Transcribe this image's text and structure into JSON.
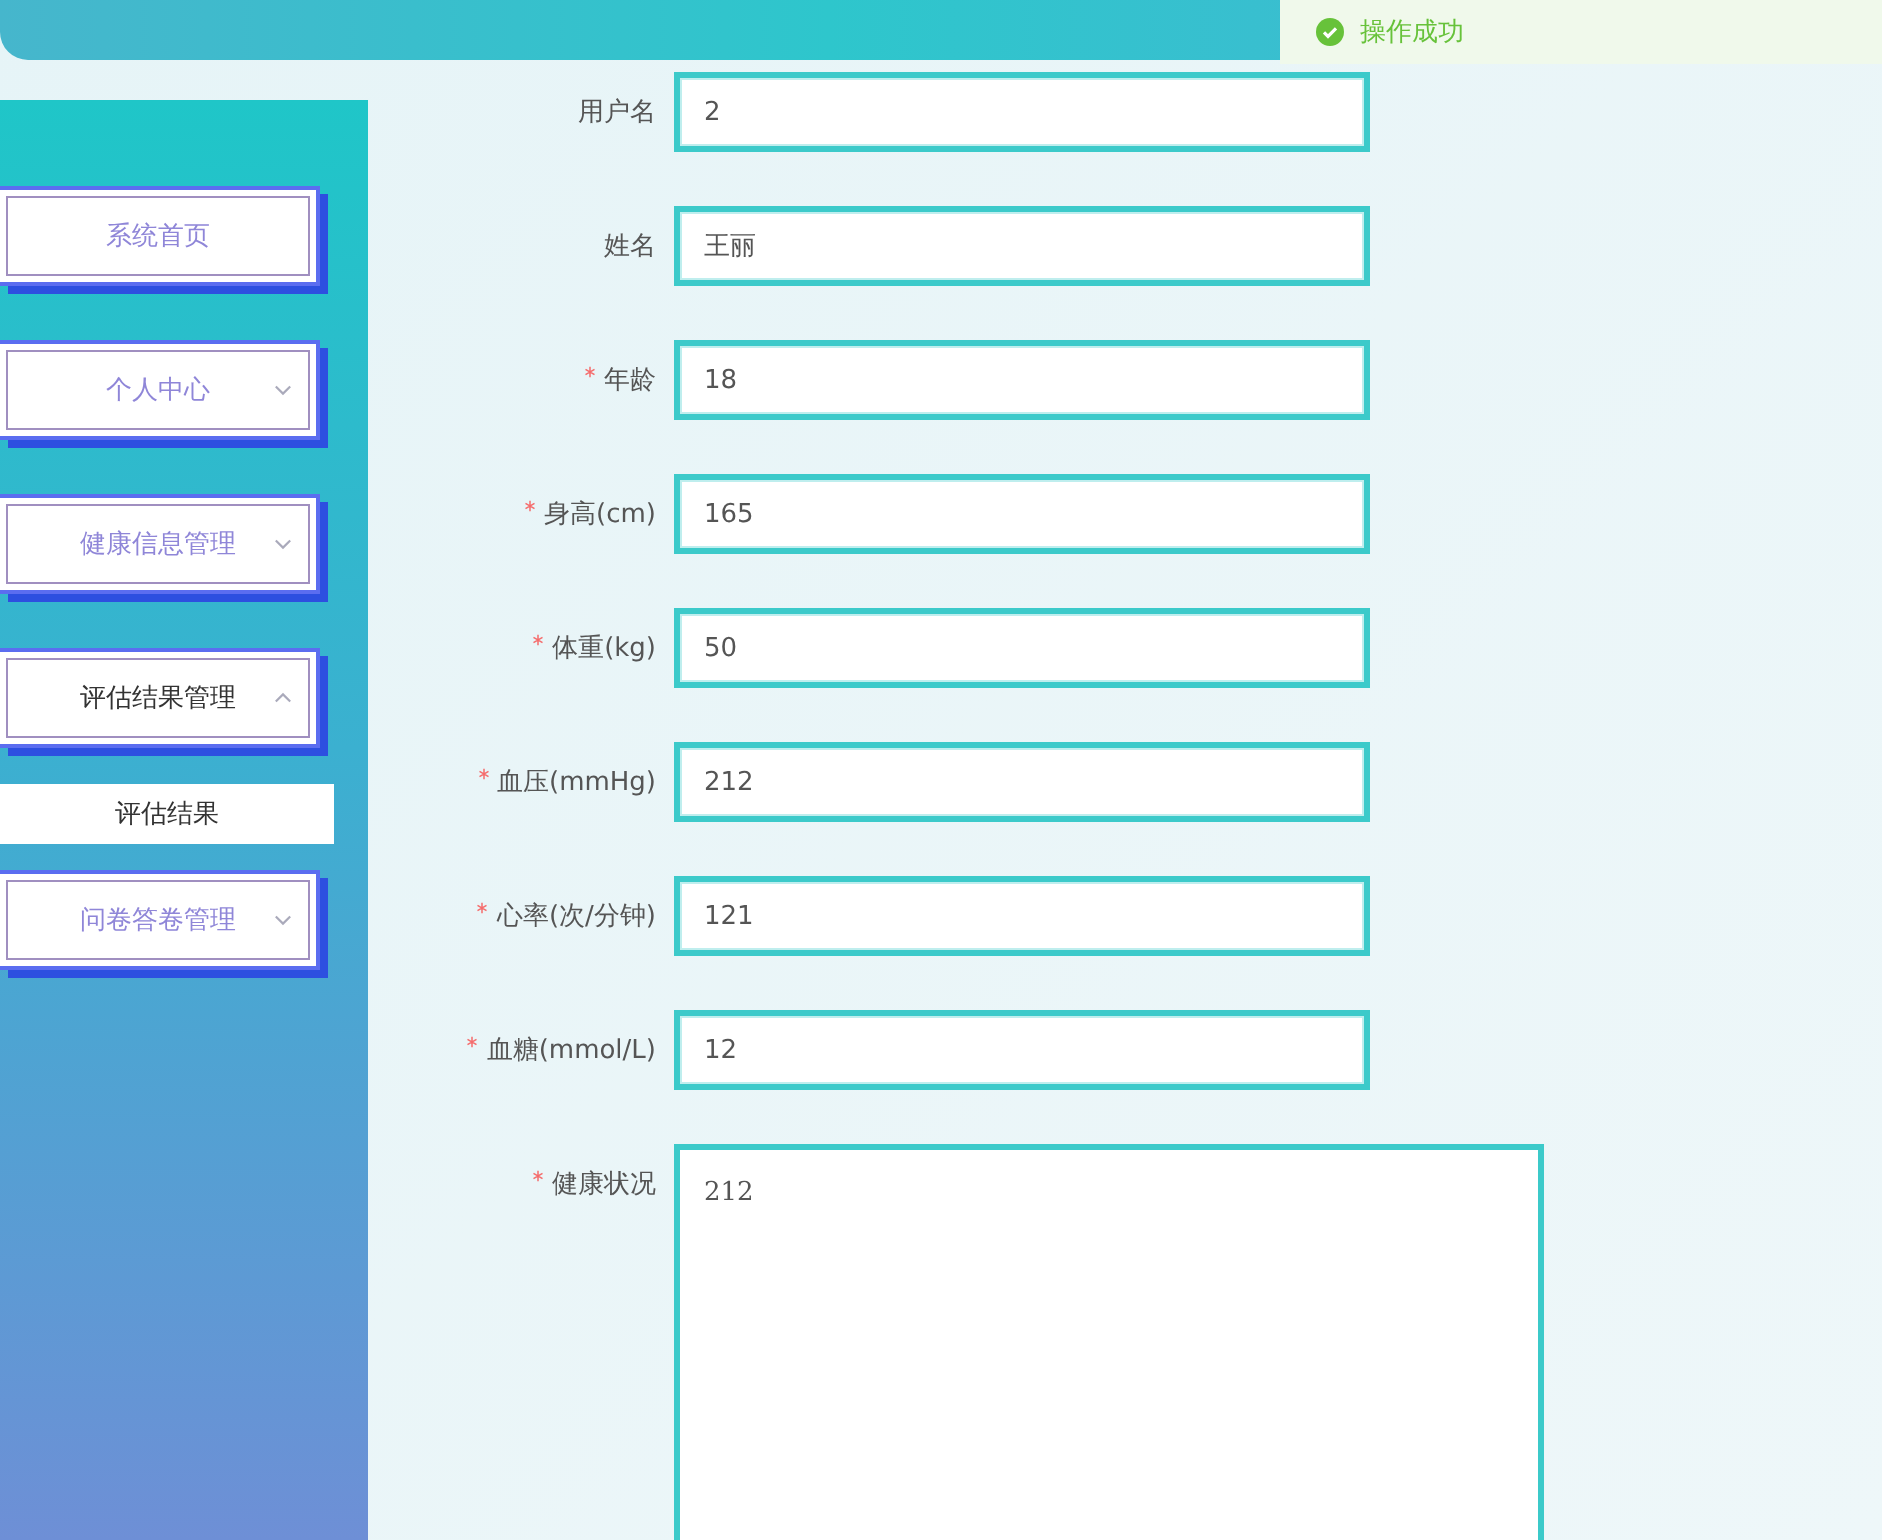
{
  "toast": {
    "text": "操作成功"
  },
  "sidebar": {
    "items": [
      {
        "label": "系统首页",
        "collapsible": false,
        "expanded": false
      },
      {
        "label": "个人中心",
        "collapsible": true,
        "expanded": false
      },
      {
        "label": "健康信息管理",
        "collapsible": true,
        "expanded": false
      },
      {
        "label": "评估结果管理",
        "collapsible": true,
        "expanded": true,
        "children": [
          {
            "label": "评估结果"
          }
        ]
      },
      {
        "label": "问卷答卷管理",
        "collapsible": true,
        "expanded": false
      }
    ]
  },
  "form": {
    "fields": [
      {
        "label": "用户名",
        "required": false,
        "kind": "input",
        "value": "2"
      },
      {
        "label": "姓名",
        "required": false,
        "kind": "input",
        "value": "王丽"
      },
      {
        "label": "年龄",
        "required": true,
        "kind": "input",
        "value": "18"
      },
      {
        "label": "身高(cm)",
        "required": true,
        "kind": "input",
        "value": "165"
      },
      {
        "label": "体重(kg)",
        "required": true,
        "kind": "input",
        "value": "50"
      },
      {
        "label": "血压(mmHg)",
        "required": true,
        "kind": "input",
        "value": "212"
      },
      {
        "label": "心率(次/分钟)",
        "required": true,
        "kind": "input",
        "value": "121"
      },
      {
        "label": "血糖(mmol/L)",
        "required": true,
        "kind": "input",
        "value": "12"
      },
      {
        "label": "健康状况",
        "required": true,
        "kind": "textarea",
        "value": "212"
      }
    ]
  }
}
